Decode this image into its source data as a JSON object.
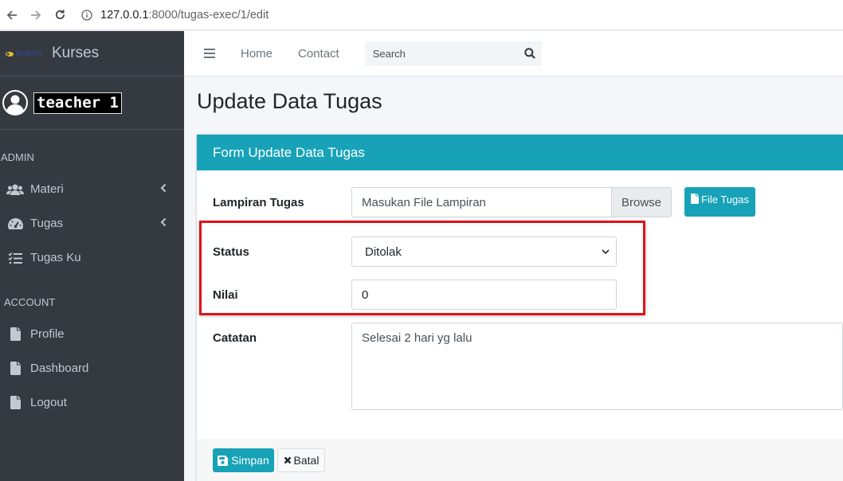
{
  "browser": {
    "url_host": "127.0.0.1",
    "url_rest": ":8000/tugas-exec/1/edit"
  },
  "sidebar": {
    "brand": "Kurses",
    "logo_text": "KURSES",
    "username": "teacher 1",
    "admin_header": "ADMIN",
    "admin_items": [
      {
        "label": "Materi",
        "icon": "users-icon"
      },
      {
        "label": "Tugas",
        "icon": "tachometer-icon"
      },
      {
        "label": "Tugas Ku",
        "icon": "tasks-icon"
      }
    ],
    "account_header": "ACCOUNT",
    "account_items": [
      {
        "label": "Profile",
        "icon": "file-icon"
      },
      {
        "label": "Dashboard",
        "icon": "file-icon"
      },
      {
        "label": "Logout",
        "icon": "file-icon"
      }
    ]
  },
  "topnav": {
    "home": "Home",
    "contact": "Contact",
    "search_placeholder": "Search"
  },
  "page": {
    "title": "Update Data Tugas"
  },
  "form": {
    "header": "Form Update Data Tugas",
    "lampiran_label": "Lampiran Tugas",
    "file_placeholder": "Masukan File Lampiran",
    "browse_label": "Browse",
    "file_button": "File Tugas",
    "status_label": "Status",
    "status_value": "Ditolak",
    "nilai_label": "Nilai",
    "nilai_value": "0",
    "catatan_label": "Catatan",
    "catatan_value": "Selesai 2 hari yg lalu",
    "save_label": "Simpan",
    "cancel_label": "Batal"
  },
  "colors": {
    "sidebar_bg": "#343a40",
    "accent": "#17a2b8",
    "highlight": "#e0121b"
  }
}
